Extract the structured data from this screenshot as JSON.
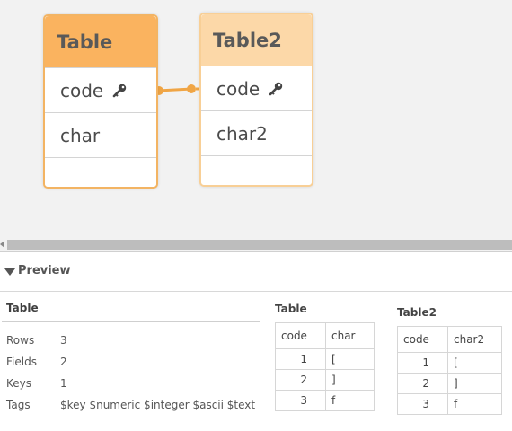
{
  "model": {
    "tables": [
      {
        "name": "Table",
        "fields": [
          {
            "name": "code",
            "key": true
          },
          {
            "name": "char",
            "key": false
          }
        ]
      },
      {
        "name": "Table2",
        "fields": [
          {
            "name": "code",
            "key": true
          },
          {
            "name": "char2",
            "key": false
          }
        ]
      }
    ],
    "key_icon": "key-icon",
    "colors": {
      "table_header": "#fab35f",
      "table2_header": "#fcd8a8",
      "link": "#f0a545"
    }
  },
  "preview": {
    "label": "Preview",
    "toggle_icon": "caret-down-icon",
    "info": {
      "title": "Table",
      "rows": [
        {
          "label": "Rows",
          "value": "3"
        },
        {
          "label": "Fields",
          "value": "2"
        },
        {
          "label": "Keys",
          "value": "1"
        },
        {
          "label": "Tags",
          "value": "$key $numeric $integer $ascii $text"
        }
      ]
    },
    "grids": [
      {
        "title": "Table",
        "columns": [
          "code",
          "char"
        ],
        "rows": [
          [
            "1",
            "["
          ],
          [
            "2",
            "]"
          ],
          [
            "3",
            "f"
          ]
        ]
      },
      {
        "title": "Table2",
        "columns": [
          "code",
          "char2"
        ],
        "rows": [
          [
            "1",
            "["
          ],
          [
            "2",
            "]"
          ],
          [
            "3",
            "f"
          ]
        ]
      }
    ]
  }
}
